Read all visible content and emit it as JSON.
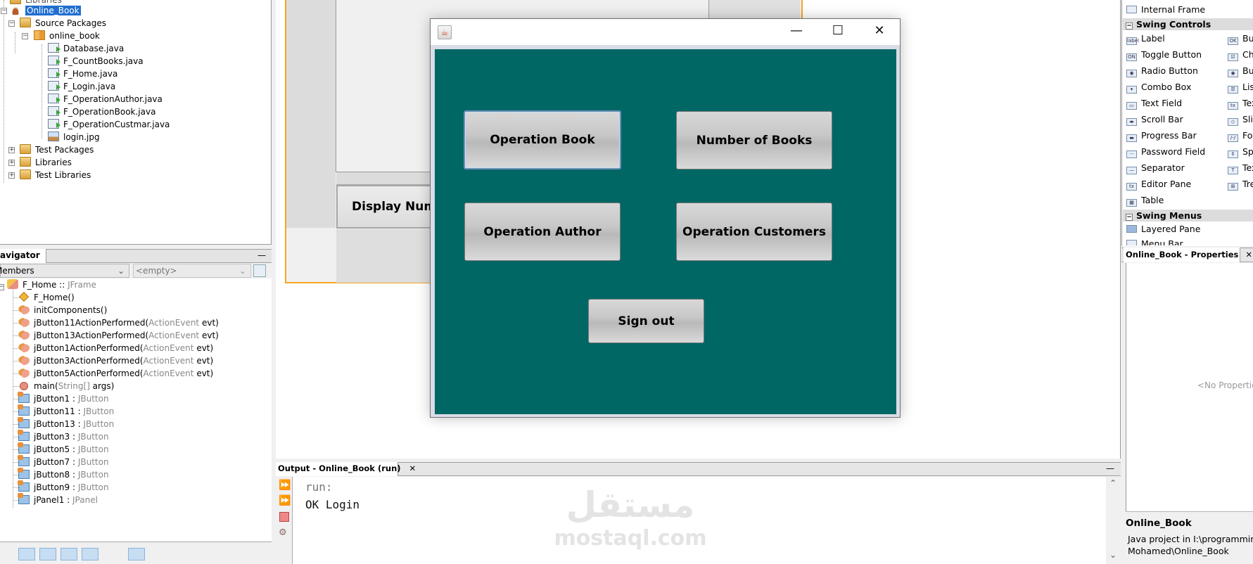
{
  "projects": {
    "partial_top_item": "Libraries",
    "project": "Online_Book",
    "source_packages": "Source Packages",
    "package": "online_book",
    "files": [
      "Database.java",
      "F_CountBooks.java",
      "F_Home.java",
      "F_Login.java",
      "F_OperationAuthor.java",
      "F_OperationBook.java",
      "F_OperationCustmar.java",
      "login.jpg"
    ],
    "test_packages": "Test Packages",
    "libraries": "Libraries",
    "test_libraries": "Test Libraries"
  },
  "navigator": {
    "tab_label": "Navigator",
    "close_glyph": "✕",
    "minimize_glyph": "—",
    "members_label": "Members",
    "filter_placeholder": "<empty>",
    "root": {
      "name": "F_Home",
      "sep": " :: ",
      "type": "JFrame"
    },
    "members": [
      {
        "kind": "ctor",
        "name": "F_Home()",
        "type": "",
        "suffix": ""
      },
      {
        "kind": "method",
        "name": "initComponents()",
        "type": "",
        "suffix": ""
      },
      {
        "kind": "method",
        "name": "jButton11ActionPerformed(",
        "type": "ActionEvent",
        "suffix": " evt)"
      },
      {
        "kind": "method",
        "name": "jButton13ActionPerformed(",
        "type": "ActionEvent",
        "suffix": " evt)"
      },
      {
        "kind": "method",
        "name": "jButton1ActionPerformed(",
        "type": "ActionEvent",
        "suffix": " evt)"
      },
      {
        "kind": "method",
        "name": "jButton3ActionPerformed(",
        "type": "ActionEvent",
        "suffix": " evt)"
      },
      {
        "kind": "method",
        "name": "jButton5ActionPerformed(",
        "type": "ActionEvent",
        "suffix": " evt)"
      },
      {
        "kind": "main",
        "name": "main(",
        "type": "String[]",
        "suffix": " args)"
      },
      {
        "kind": "field",
        "name": "jButton1 : ",
        "type": "JButton",
        "suffix": ""
      },
      {
        "kind": "field",
        "name": "jButton11 : ",
        "type": "JButton",
        "suffix": ""
      },
      {
        "kind": "field",
        "name": "jButton13 : ",
        "type": "JButton",
        "suffix": ""
      },
      {
        "kind": "field",
        "name": "jButton3 : ",
        "type": "JButton",
        "suffix": ""
      },
      {
        "kind": "field",
        "name": "jButton5 : ",
        "type": "JButton",
        "suffix": ""
      },
      {
        "kind": "field",
        "name": "jButton7 : ",
        "type": "JButton",
        "suffix": ""
      },
      {
        "kind": "field",
        "name": "jButton8 : ",
        "type": "JButton",
        "suffix": ""
      },
      {
        "kind": "field",
        "name": "jButton9 : ",
        "type": "JButton",
        "suffix": ""
      },
      {
        "kind": "field",
        "name": "jPanel1 : ",
        "type": "JPanel",
        "suffix": ""
      }
    ],
    "toolbar_icons": [
      "show-inherited-icon",
      "show-fields-icon",
      "show-static-icon",
      "show-nonpublic-icon",
      "show-inner-icon",
      "filter-icon",
      "sort-alpha-icon",
      "sort-source-icon"
    ]
  },
  "designer": {
    "display_button_label": "Display Num"
  },
  "dialog": {
    "app_icon_glyph": "☕",
    "minimize_glyph": "—",
    "maximize_glyph": "☐",
    "close_glyph": "✕",
    "background_color": "#016765",
    "buttons": {
      "operation_book": "Operation Book",
      "number_of_books": "Number of Books",
      "operation_author": "Operation Author",
      "operation_customers": "Operation Customers",
      "sign_out": "Sign out"
    }
  },
  "output": {
    "tab_label": "Output - Online_Book (run)",
    "close_glyph": "✕",
    "minimize_glyph": "—",
    "lines": [
      "run:",
      "OK Login"
    ],
    "watermark_arabic": "مستقل",
    "watermark_latin": "mostaql.com",
    "scroll_up": "⌃",
    "scroll_down": "⌄"
  },
  "palette": {
    "top_item": "Internal Frame",
    "swing_controls": "Swing Controls",
    "swing_menus": "Swing Menus",
    "col1": [
      "Label",
      "Toggle Button",
      "Radio Button",
      "Combo Box",
      "Text Field",
      "Scroll Bar",
      "Progress Bar",
      "Password Field",
      "Separator",
      "Editor Pane",
      "Table"
    ],
    "col1_icons": [
      "label",
      "ON",
      "◉",
      "▾",
      "▭",
      "◂▸",
      "▬",
      "···",
      "—",
      "tx",
      "▦"
    ],
    "col2": [
      "But",
      "Che",
      "But",
      "List",
      "Tex",
      "Slic",
      "For",
      "Spi",
      "Tex",
      "Tre"
    ],
    "col2_icons": [
      "OK",
      "☑",
      "◉",
      "☰",
      "tx",
      "◇",
      "/-/",
      "⇕",
      "T",
      "⊞"
    ],
    "menus_first": "Layered Pane",
    "menus_partial": "Menu Bar"
  },
  "properties": {
    "tab_label": "Online_Book - Properties",
    "close_glyph": "✕",
    "empty_text": "<No Properties>",
    "desc_title": "Online_Book",
    "desc_line1": "Java project in I:\\programming",
    "desc_line2": "Mohamed\\Online_Book"
  }
}
